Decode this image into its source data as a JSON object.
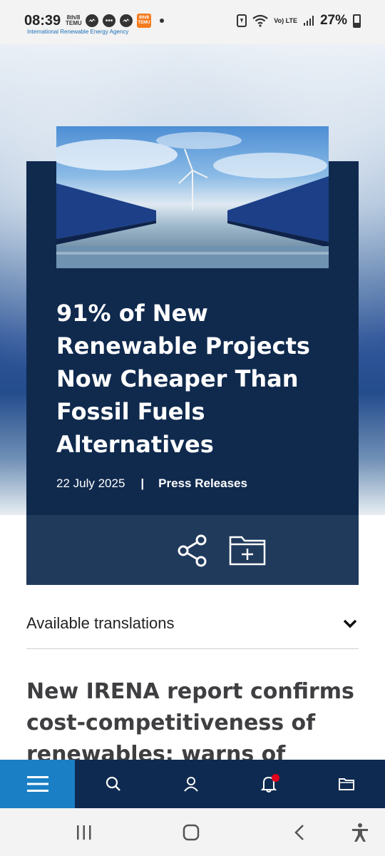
{
  "status_bar": {
    "time": "08:39",
    "temu_label": "8th/8 TEMU",
    "network": "Vo) LTE",
    "battery": "27%"
  },
  "header": {
    "agency_name": "International Renewable Energy Agency"
  },
  "hero": {
    "headline": "91% of New Renewable Projects Now Cheaper Than Fossil Fuels Alternatives",
    "date": "22 July 2025",
    "separator": "|",
    "category": "Press Releases"
  },
  "actions": {
    "share_icon": "share-icon",
    "save_icon": "folder-add-icon"
  },
  "translations": {
    "label": "Available translations",
    "icon": "chevron-down-icon"
  },
  "article": {
    "title": "New IRENA report confirms cost-competitiveness of renewables; warns of"
  },
  "site_nav": {
    "items": [
      {
        "name": "menu",
        "icon": "menu-icon",
        "active": true
      },
      {
        "name": "search",
        "icon": "search-icon"
      },
      {
        "name": "account",
        "icon": "user-icon"
      },
      {
        "name": "notifications",
        "icon": "bell-icon",
        "has_badge": true
      },
      {
        "name": "saved",
        "icon": "folder-icon"
      }
    ]
  },
  "colors": {
    "navy": "#0e2a50",
    "card": "#203a5c",
    "accent": "#1a7fc4",
    "badge": "#e3001b"
  }
}
